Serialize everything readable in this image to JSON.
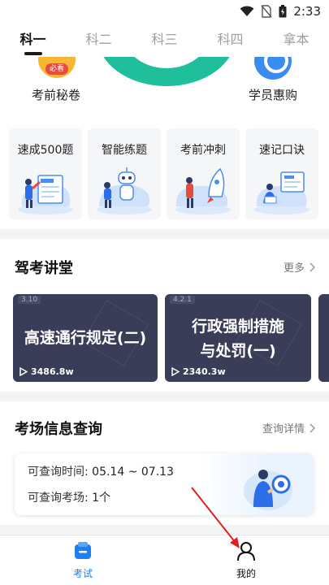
{
  "status_bar": {
    "time": "2:33",
    "icons": [
      "wifi-icon",
      "no-sim-icon",
      "battery-icon"
    ]
  },
  "subject_tabs": [
    {
      "label": "科一",
      "active": true
    },
    {
      "label": "科二",
      "active": false
    },
    {
      "label": "科三",
      "active": false
    },
    {
      "label": "科四",
      "active": false
    },
    {
      "label": "拿本",
      "active": false
    }
  ],
  "quick_entries": {
    "left": {
      "label": "考前秘卷",
      "badge": "必看"
    },
    "right": {
      "label": "学员惠购"
    }
  },
  "feature_cards": [
    {
      "title": "速成500题",
      "icon": "book-500-icon"
    },
    {
      "title": "智能练题",
      "icon": "robot-icon"
    },
    {
      "title": "考前冲刺",
      "icon": "rocket-icon"
    },
    {
      "title": "速记口诀",
      "icon": "notebook-icon"
    }
  ],
  "lecture": {
    "title": "驾考讲堂",
    "more_label": "更多",
    "videos": [
      {
        "tag": "3.10",
        "title": "高速通行规定(二)",
        "plays": "3486.8w"
      },
      {
        "tag": "4.2.1",
        "title_line1": "行政强制措施",
        "title_line2": "与处罚(一)",
        "plays": "2340.3w"
      }
    ]
  },
  "exam_info": {
    "title": "考场信息查询",
    "detail_label": "查询详情",
    "time_key": "可查询时间:",
    "time_value": "05.14 ~ 07.13",
    "site_key": "可查询考场:",
    "site_value": "1个"
  },
  "bottom_nav": [
    {
      "label": "考试",
      "active": true,
      "icon": "exam-icon"
    },
    {
      "label": "我的",
      "active": false,
      "icon": "user-icon"
    }
  ],
  "colors": {
    "accent": "#1e7ff0",
    "teal": "#1fbf9b",
    "annotation_arrow": "#e02020",
    "video_bg": "#3a3d57"
  }
}
